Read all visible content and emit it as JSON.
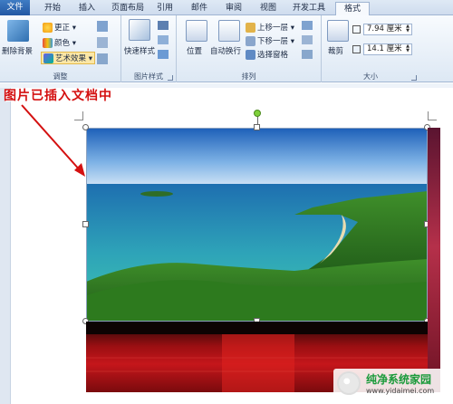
{
  "tabs": [
    {
      "label": "文件",
      "cls": "file"
    },
    {
      "label": "开始"
    },
    {
      "label": "插入"
    },
    {
      "label": "页面布局"
    },
    {
      "label": "引用"
    },
    {
      "label": "邮件"
    },
    {
      "label": "审阅"
    },
    {
      "label": "视图"
    },
    {
      "label": "开发工具"
    },
    {
      "label": "格式",
      "active": true
    }
  ],
  "ribbon": {
    "remove_background": "删除背景",
    "corrections": "更正",
    "color": "颜色",
    "artistic_effects": "艺术效果",
    "adjust_group": "调整",
    "quick_styles": "快速样式",
    "picture_styles_group": "图片样式",
    "position": "位置",
    "wrap_text": "自动换行",
    "bring_forward": "上移一层",
    "send_backward": "下移一层",
    "selection_pane": "选择窗格",
    "arrange_group": "排列",
    "crop": "裁剪",
    "height_value": "7.94 厘米",
    "width_value": "14.1 厘米",
    "size_group": "大小"
  },
  "document": {
    "annotation": "图片已插入文档中"
  },
  "watermark": {
    "title": "纯净系统家园",
    "url": "www.yidaimei.com"
  },
  "colors": {
    "accent": "#2358a3",
    "annotation": "#d41010"
  }
}
